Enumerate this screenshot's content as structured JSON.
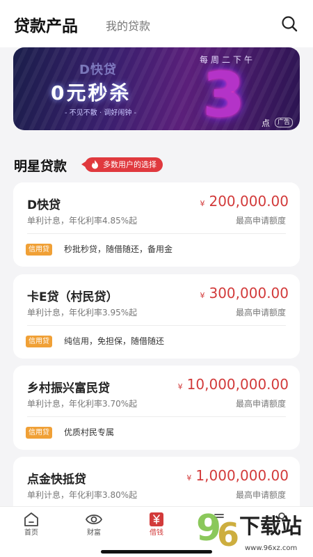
{
  "header": {
    "active_tab": "贷款产品",
    "inactive_tab": "我的贷款",
    "search_icon": "search-icon"
  },
  "banner": {
    "subtitle": "D快贷",
    "main": "0元秒杀",
    "tagline": "- 不见不散 · 调好闹钟 -",
    "week": "每周二下午",
    "number": "3",
    "dian": "点",
    "ad_label": "广告"
  },
  "section": {
    "title": "明星贷款",
    "badge": "多数用户的选择",
    "badge_icon": "fire-icon"
  },
  "loans": [
    {
      "name": "D快贷",
      "currency": "¥",
      "amount": "200,000.00",
      "rate": "单利计息，年化利率4.85%起",
      "limit_label": "最高申请额度",
      "tag": "信用贷",
      "feature": "秒批秒贷，随借随还，备用金"
    },
    {
      "name": "卡E贷（村民贷）",
      "currency": "¥",
      "amount": "300,000.00",
      "rate": "单利计息，年化利率3.95%起",
      "limit_label": "最高申请额度",
      "tag": "信用贷",
      "feature": "纯信用，免担保，随借随还"
    },
    {
      "name": "乡村振兴富民贷",
      "currency": "¥",
      "amount": "10,000,000.00",
      "rate": "单利计息，年化利率3.70%起",
      "limit_label": "最高申请额度",
      "tag": "信用贷",
      "feature": "优质村民专属"
    },
    {
      "name": "点金快抵贷",
      "currency": "¥",
      "amount": "1,000,000.00",
      "rate": "单利计息，年化利率3.80%起",
      "limit_label": "最高申请额度"
    }
  ],
  "tabbar": {
    "items": [
      {
        "label": "首页",
        "icon": "home-icon"
      },
      {
        "label": "财富",
        "icon": "eye-icon"
      },
      {
        "label": "借钱",
        "icon": "yen-icon"
      },
      {
        "label": "",
        "icon": "menu-icon"
      },
      {
        "label": "",
        "icon": "profile-icon"
      }
    ]
  },
  "watermark": {
    "nine": "9",
    "six": "6",
    "text": "下载站",
    "url": "www.96xz.com"
  },
  "colors": {
    "accent_red": "#d23a3a",
    "tag_orange": "#f0a036",
    "watermark_green": "#7fc34a"
  }
}
